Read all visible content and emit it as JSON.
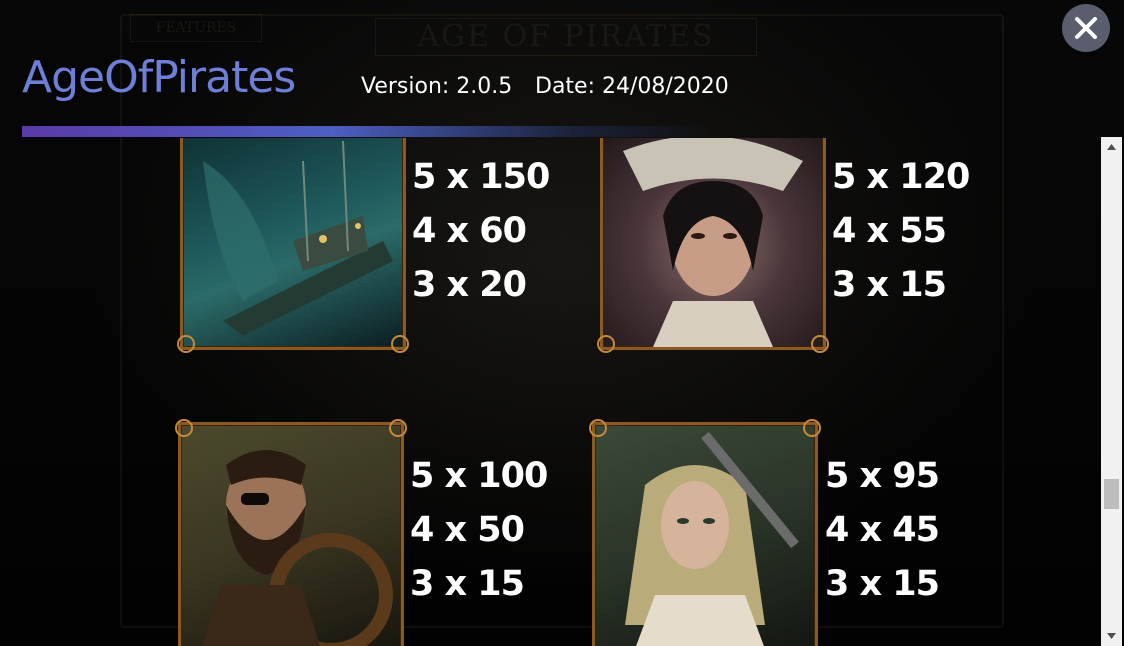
{
  "app": {
    "title": "AgeOfPirates",
    "version": "Version: 2.0.5",
    "date": "Date: 24/08/2020"
  },
  "background": {
    "game_title": "AGE OF PIRATES",
    "features_label": "FEATURES"
  },
  "close_icon": "close-icon",
  "symbols": [
    {
      "name": "ship",
      "payouts": [
        "5 x 150",
        "4 x 60",
        "3 x 20"
      ],
      "colors": [
        "#0f3a3c",
        "#2a6a6a",
        "#0a1f22"
      ]
    },
    {
      "name": "female-pirate-captain",
      "payouts": [
        "5 x 120",
        "4 x 55",
        "3 x 15"
      ],
      "colors": [
        "#3b2a30",
        "#8a6b6a",
        "#1f1618"
      ]
    },
    {
      "name": "bearded-pirate",
      "payouts": [
        "5 x 100",
        "4 x 50",
        "3 x 15"
      ],
      "colors": [
        "#3a3a22",
        "#6b6238",
        "#1d1a10"
      ]
    },
    {
      "name": "blonde-pirate",
      "payouts": [
        "5 x 95",
        "4 x 45",
        "3 x 15"
      ],
      "colors": [
        "#2d3a2a",
        "#a8a080",
        "#1a2018"
      ]
    }
  ]
}
